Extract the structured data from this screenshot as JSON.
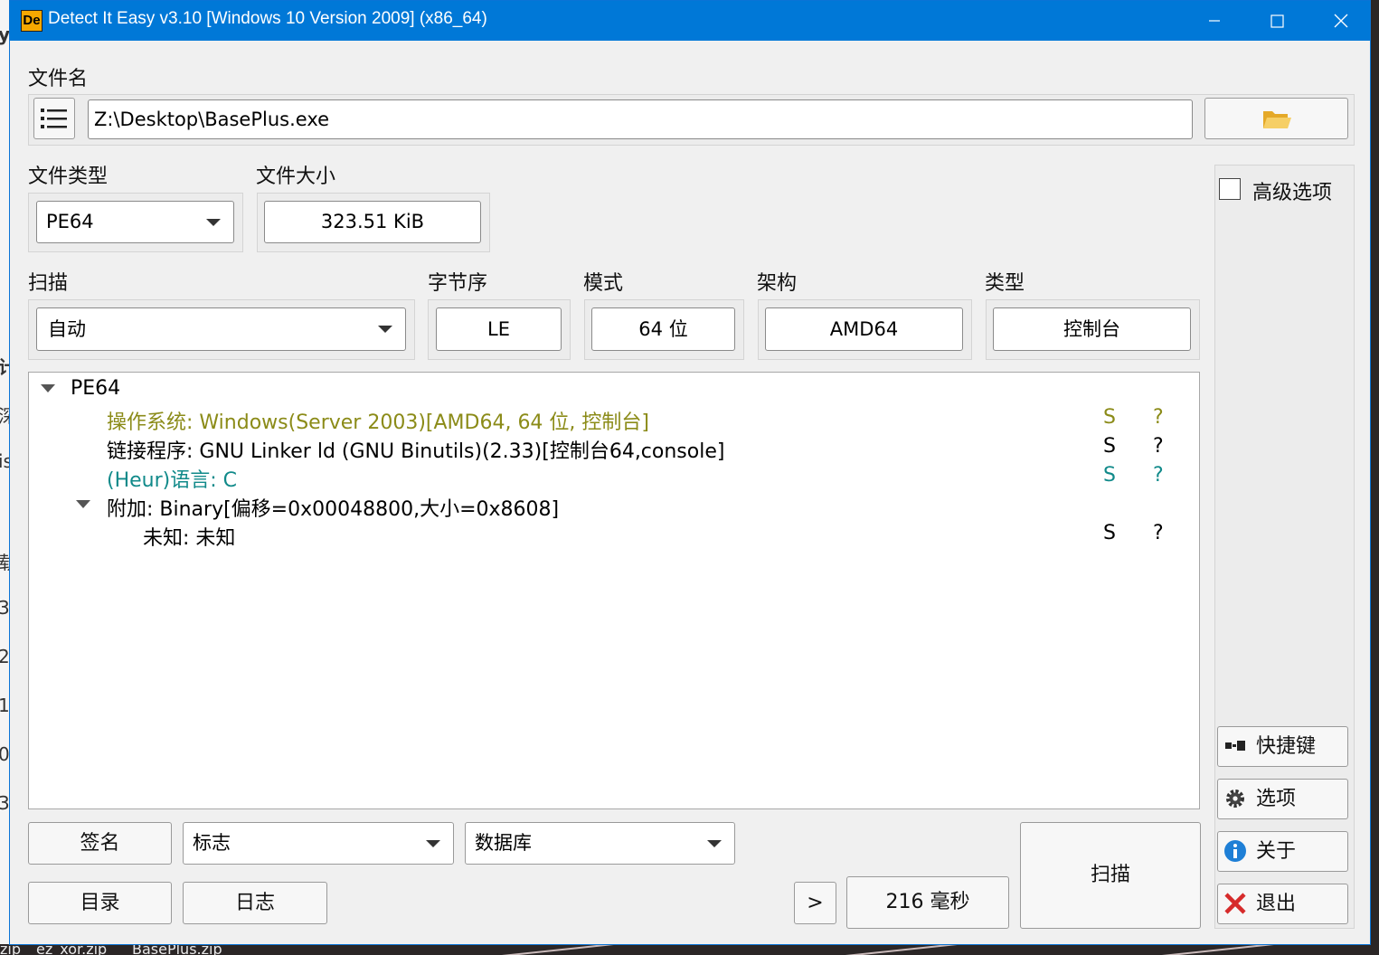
{
  "window": {
    "title": "Detect It Easy v3.10 [Windows 10 Version 2009] (x86_64)",
    "logo_text": "De",
    "controls": {
      "minimize": "—",
      "maximize": "☐",
      "close": "✕"
    }
  },
  "file": {
    "label": "文件名",
    "path": "Z:\\Desktop\\BasePlus.exe"
  },
  "file_type": {
    "label": "文件类型",
    "value": "PE64"
  },
  "file_size": {
    "label": "文件大小",
    "value": "323.51 KiB"
  },
  "advanced": {
    "label": "高级选项",
    "checked": false
  },
  "scan_mode": {
    "label": "扫描",
    "value": "自动"
  },
  "endianness": {
    "label": "字节序",
    "value": "LE"
  },
  "mode": {
    "label": "模式",
    "value": "64 位"
  },
  "arch": {
    "label": "架构",
    "value": "AMD64"
  },
  "type": {
    "label": "类型",
    "value": "控制台"
  },
  "results": {
    "root": "PE64",
    "rows": [
      {
        "text": "操作系统: Windows(Server 2003)[AMD64, 64 位, 控制台]",
        "s": "S",
        "q": "?",
        "color": "#8b8b18"
      },
      {
        "text": "链接程序: GNU Linker ld (GNU Binutils)(2.33)[控制台64,console]",
        "s": "S",
        "q": "?",
        "color": "#111111"
      },
      {
        "text": "(Heur)语言: C",
        "s": "S",
        "q": "?",
        "color": "#118a8a"
      }
    ],
    "overlay": "附加: Binary[偏移=0x00048800,大小=0x8608]",
    "overlay_child": {
      "text": "未知: 未知",
      "s": "S",
      "q": "?"
    }
  },
  "bottom": {
    "signatures": "签名",
    "flags": "标志",
    "database": "数据库",
    "directory": "目录",
    "log": "日志",
    "more": ">",
    "elapsed": "216 毫秒",
    "scan": "扫描"
  },
  "side": {
    "shortcuts": "快捷键",
    "options": "选项",
    "about": "关于",
    "exit": "退出"
  },
  "background": {
    "taskbar_items": [
      "zip",
      "ez_xor.zip",
      "BasePlus.zip"
    ],
    "edge_chars": [
      "yp",
      "计",
      "深",
      "is",
      "载",
      "3",
      "2",
      "1",
      "0",
      "3"
    ]
  },
  "colors": {
    "titlebar": "#0078d7",
    "folder": "#f2c14e",
    "info": "#1e7fd6",
    "exit": "#d62b2b"
  }
}
